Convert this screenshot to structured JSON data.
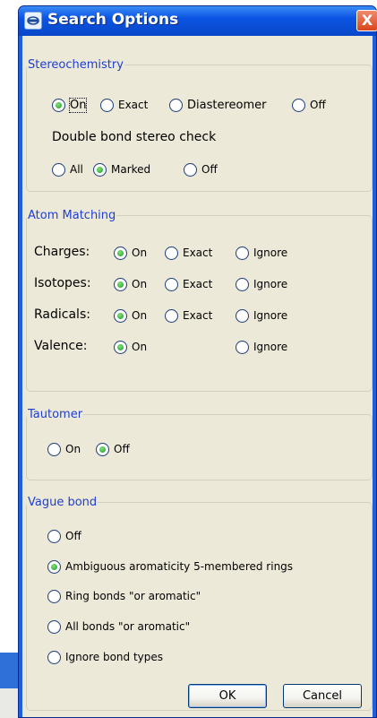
{
  "dialog": {
    "title": "Search Options",
    "close_label": "X"
  },
  "stereo": {
    "legend": "Stereochemistry",
    "options": [
      "On",
      "Exact",
      "Diastereomer",
      "Off"
    ],
    "double_bond_label": "Double bond stereo check",
    "double_bond_options": [
      "All",
      "Marked",
      "Off"
    ]
  },
  "atom": {
    "legend": "Atom Matching",
    "charges_label": "Charges:",
    "isotopes_label": "Isotopes:",
    "radicals_label": "Radicals:",
    "valence_label": "Valence:",
    "on": "On",
    "exact": "Exact",
    "ignore": "Ignore"
  },
  "tautomer": {
    "legend": "Tautomer",
    "options": [
      "On",
      "Off"
    ]
  },
  "vague": {
    "legend": "Vague bond",
    "options": [
      "Off",
      "Ambiguous aromaticity 5-membered rings",
      "Ring bonds \"or aromatic\"",
      "All bonds \"or aromatic\"",
      "Ignore bond types"
    ]
  },
  "buttons": {
    "ok": "OK",
    "cancel": "Cancel"
  }
}
